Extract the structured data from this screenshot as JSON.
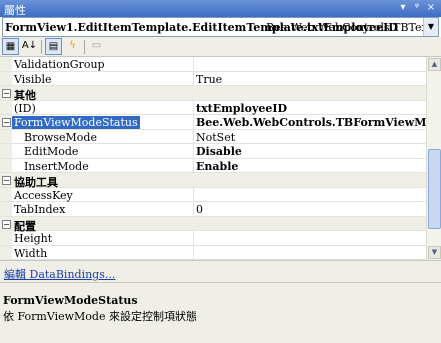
{
  "window": {
    "title": "屬性",
    "pin_glyph": "ᵠ",
    "dropdown_glyph": "▾",
    "close_glyph": "×"
  },
  "object_selector": {
    "name": "FormView1.EditItemTemplate.EditItemTemplate.txtEmployeeID",
    "type": "Bee.Web.WebControls.TBTextBo",
    "drop_glyph": "▼"
  },
  "toolbar": {
    "categorized_glyph": "▦",
    "alphabetical_glyph": "A↓",
    "properties_glyph": "▤",
    "events_glyph": "ϟ",
    "pages_glyph": "▭"
  },
  "grid": {
    "rows": [
      {
        "kind": "prop",
        "name": "ValidationGroup",
        "value": ""
      },
      {
        "kind": "prop",
        "name": "Visible",
        "value": "True"
      },
      {
        "kind": "cat",
        "toggle": "−",
        "name": "其他"
      },
      {
        "kind": "prop",
        "name": "(ID)",
        "value": "txtEmployeeID",
        "bold": true
      },
      {
        "kind": "cat",
        "toggle": "−",
        "name": "FormViewModeStatus",
        "value": "Bee.Web.WebControls.TBFormViewModeStatus",
        "bold": true,
        "selected": true
      },
      {
        "kind": "prop",
        "name": "BrowseMode",
        "value": "NotSet",
        "indent": true
      },
      {
        "kind": "prop",
        "name": "EditMode",
        "value": "Disable",
        "bold": true,
        "indent": true
      },
      {
        "kind": "prop",
        "name": "InsertMode",
        "value": "Enable",
        "bold": true,
        "indent": true
      },
      {
        "kind": "cat",
        "toggle": "−",
        "name": "協助工具"
      },
      {
        "kind": "prop",
        "name": "AccessKey",
        "value": ""
      },
      {
        "kind": "prop",
        "name": "TabIndex",
        "value": "0"
      },
      {
        "kind": "cat",
        "toggle": "−",
        "name": "配置"
      },
      {
        "kind": "prop",
        "name": "Height",
        "value": ""
      },
      {
        "kind": "prop",
        "name": "Width",
        "value": ""
      }
    ]
  },
  "commands": {
    "edit_databindings": "編輯 DataBindings..."
  },
  "description": {
    "title": "FormViewModeStatus",
    "text": "依 FormViewMode 來設定控制項狀態"
  }
}
